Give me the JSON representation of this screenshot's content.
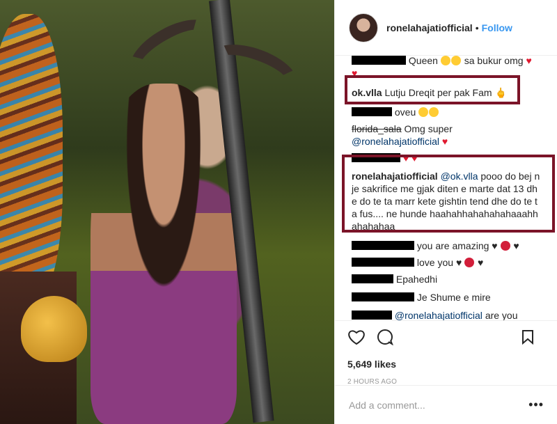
{
  "header": {
    "username": "ronelahajatiofficial",
    "dot": "•",
    "follow": "Follow"
  },
  "comments": [
    {
      "user_visible": "",
      "text": "Queen",
      "suffix": "sa bukur omg"
    },
    {
      "user": "ok.vlla",
      "text": "Lutju Dreqit per pak Fam"
    },
    {
      "text": "oveu"
    },
    {
      "user_visible": "florida_sala",
      "text": "Omg super"
    },
    {
      "mention": "@ronelahajatiofficial"
    },
    {
      "user": "ronelahajatiofficial",
      "mention": "@ok.vlla",
      "text": "pooo do bej nje sakrifice me gjak diten e marte dat 13 dhe do te ta marr kete gishtin tend dhe do te ta fus.... ne hunde haahahhahahahahaaahhahahahaa"
    },
    {
      "text": "you are amazing"
    },
    {
      "text": "love you"
    },
    {
      "text": "Epahedhi"
    },
    {
      "text": "Je Shume e mire"
    },
    {
      "mention": "@ronelahajatiofficial",
      "text": "are you FUCKING SERIOUS !?"
    }
  ],
  "actions": {
    "likes": "5,649 likes",
    "ago": "2 HOURS AGO",
    "add_comment_placeholder": "Add a comment...",
    "more": "•••"
  },
  "colors": {
    "accent": "#3897f0",
    "highlight_box": "#7b1428",
    "heart": "#e0192f"
  }
}
